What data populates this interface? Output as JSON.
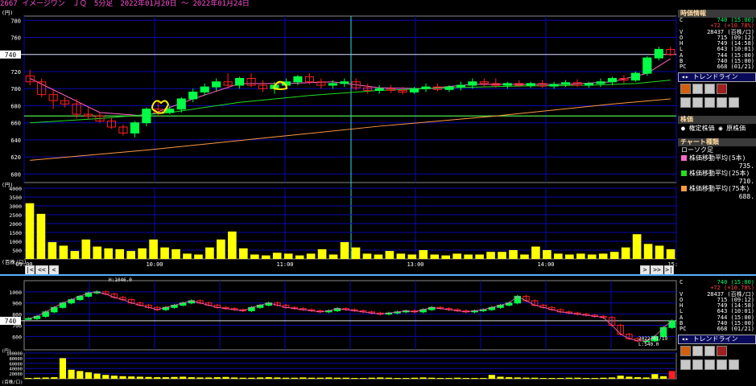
{
  "header": {
    "title": "2667 イメージワン　ＪＱ　5分足　2022年01月20日 〜 2022年01月24日"
  },
  "quote_panel": {
    "title": "時価情報",
    "rows": [
      {
        "k": "C",
        "v": "740 (15:00)",
        "cls": "up"
      },
      {
        "k": "",
        "v": "+72 (+10.78%)",
        "cls": "red"
      },
      {
        "k": "V",
        "v": "28437 (百株/口)",
        "cls": ""
      },
      {
        "k": "O",
        "v": "715 (09:12)",
        "cls": ""
      },
      {
        "k": "H",
        "v": "749 (14:58)",
        "cls": ""
      },
      {
        "k": "L",
        "v": "643 (10:01)",
        "cls": ""
      },
      {
        "k": "A",
        "v": "744 (15:00)",
        "cls": ""
      },
      {
        "k": "B",
        "v": "740 (15:00)",
        "cls": ""
      },
      {
        "k": "PC",
        "v": "668 (01/21)",
        "cls": ""
      }
    ]
  },
  "trendline_label": "トレンドライン",
  "price_section": {
    "title": "株価",
    "option1": "権定株価",
    "option2": "原株価"
  },
  "chart_type": {
    "title": "チャート種類",
    "candle": "ローソク足",
    "ma5": "株価移動平均(5本)",
    "ma5_val": "735.",
    "ma25": "株価移動平均(25本)",
    "ma25_val": "710.",
    "ma75": "株価移動平均(75本)",
    "ma75_val": "688."
  },
  "mini_quote_rows": [
    {
      "k": "C",
      "v": "740 (15:00)",
      "cls": "up"
    },
    {
      "k": "",
      "v": "+72 (+10.78%)",
      "cls": "red"
    },
    {
      "k": "V",
      "v": "28437 (百株/口)",
      "cls": ""
    },
    {
      "k": "O",
      "v": "715 (09:12)",
      "cls": ""
    },
    {
      "k": "H",
      "v": "749 (14:58)",
      "cls": ""
    },
    {
      "k": "L",
      "v": "643 (10:01)",
      "cls": ""
    },
    {
      "k": "A",
      "v": "744 (15:00)",
      "cls": ""
    },
    {
      "k": "B",
      "v": "740 (15:00)",
      "cls": ""
    },
    {
      "k": "PC",
      "v": "668 (01/21)",
      "cls": ""
    }
  ],
  "colors": {
    "up": "#00ff44",
    "down": "#ff2020",
    "ma5": "#ff66cc",
    "ma25": "#22dd22",
    "ma75": "#ff9944",
    "grid": "#0a0ab0",
    "volume": "#ffff00",
    "hline": "#55ff55",
    "vline": "#33dddd"
  },
  "chart_data": [
    {
      "type": "candlestick",
      "name": "main",
      "ylim": [
        590,
        785
      ],
      "y_ticks": [
        600,
        620,
        640,
        660,
        680,
        700,
        720,
        740,
        760,
        780
      ],
      "y_tick_labels": [
        "600",
        "620",
        "640",
        "660",
        "680",
        "700",
        "720",
        "740",
        "760",
        "780"
      ],
      "y_unit": "(円)",
      "current_price_label": "740",
      "current_price": 740,
      "reference_line": 668,
      "x_tick_labels": [
        {
          "label": "09:00",
          "i": 0
        },
        {
          "label": "10:00",
          "i": 12
        },
        {
          "label": "11:00",
          "i": 24
        },
        {
          "label": "13:00",
          "i": 36
        },
        {
          "label": "14:00",
          "i": 48
        },
        {
          "label": "15:00",
          "i": 60
        }
      ],
      "candles": [
        [
          715,
          722,
          704,
          708
        ],
        [
          708,
          712,
          690,
          693
        ],
        [
          693,
          700,
          676,
          686
        ],
        [
          686,
          690,
          678,
          682
        ],
        [
          682,
          688,
          665,
          670
        ],
        [
          670,
          678,
          664,
          668
        ],
        [
          668,
          672,
          660,
          662
        ],
        [
          662,
          666,
          653,
          655
        ],
        [
          655,
          658,
          645,
          648
        ],
        [
          648,
          662,
          643,
          660
        ],
        [
          660,
          678,
          656,
          676
        ],
        [
          676,
          684,
          668,
          672
        ],
        [
          672,
          680,
          670,
          676
        ],
        [
          676,
          690,
          672,
          688
        ],
        [
          688,
          700,
          684,
          696
        ],
        [
          696,
          706,
          692,
          702
        ],
        [
          702,
          712,
          697,
          708
        ],
        [
          708,
          718,
          700,
          704
        ],
        [
          704,
          714,
          700,
          712
        ],
        [
          712,
          718,
          702,
          704
        ],
        [
          704,
          710,
          696,
          700
        ],
        [
          700,
          708,
          694,
          704
        ],
        [
          704,
          712,
          700,
          708
        ],
        [
          708,
          716,
          704,
          714
        ],
        [
          714,
          718,
          705,
          708
        ],
        [
          708,
          712,
          700,
          704
        ],
        [
          704,
          710,
          700,
          706
        ],
        [
          706,
          712,
          702,
          708
        ],
        [
          708,
          712,
          698,
          701
        ],
        [
          701,
          706,
          694,
          698
        ],
        [
          698,
          704,
          694,
          700
        ],
        [
          700,
          704,
          695,
          698
        ],
        [
          698,
          702,
          693,
          696
        ],
        [
          696,
          702,
          694,
          700
        ],
        [
          700,
          706,
          696,
          702
        ],
        [
          702,
          706,
          697,
          699
        ],
        [
          699,
          704,
          696,
          702
        ],
        [
          702,
          708,
          698,
          704
        ],
        [
          704,
          712,
          700,
          708
        ],
        [
          708,
          712,
          702,
          706
        ],
        [
          706,
          712,
          701,
          704
        ],
        [
          704,
          708,
          700,
          706
        ],
        [
          706,
          710,
          702,
          704
        ],
        [
          704,
          708,
          701,
          706
        ],
        [
          706,
          710,
          701,
          703
        ],
        [
          703,
          708,
          700,
          705
        ],
        [
          705,
          710,
          702,
          707
        ],
        [
          707,
          711,
          702,
          704
        ],
        [
          704,
          708,
          701,
          706
        ],
        [
          706,
          712,
          702,
          708
        ],
        [
          708,
          714,
          704,
          712
        ],
        [
          712,
          716,
          706,
          710
        ],
        [
          710,
          720,
          708,
          718
        ],
        [
          718,
          738,
          715,
          736
        ],
        [
          736,
          749,
          733,
          746
        ],
        [
          746,
          749,
          738,
          740
        ]
      ],
      "ma5": [
        [
          0,
          712
        ],
        [
          6,
          672
        ],
        [
          10,
          668
        ],
        [
          14,
          688
        ],
        [
          18,
          706
        ],
        [
          22,
          706
        ],
        [
          26,
          708
        ],
        [
          30,
          701
        ],
        [
          34,
          700
        ],
        [
          38,
          705
        ],
        [
          42,
          705
        ],
        [
          46,
          705
        ],
        [
          50,
          708
        ],
        [
          53,
          718
        ],
        [
          55,
          735
        ]
      ],
      "ma25": [
        [
          0,
          660
        ],
        [
          6,
          665
        ],
        [
          12,
          672
        ],
        [
          18,
          684
        ],
        [
          24,
          692
        ],
        [
          30,
          698
        ],
        [
          36,
          701
        ],
        [
          42,
          703
        ],
        [
          48,
          704
        ],
        [
          52,
          706
        ],
        [
          55,
          710
        ]
      ],
      "ma75": [
        [
          0,
          616
        ],
        [
          10,
          628
        ],
        [
          20,
          642
        ],
        [
          30,
          656
        ],
        [
          40,
          668
        ],
        [
          50,
          682
        ],
        [
          55,
          688
        ]
      ]
    },
    {
      "type": "bar",
      "name": "main-volume",
      "ylim": [
        0,
        4000
      ],
      "y_ticks": [
        500,
        1000,
        1500,
        2000,
        2500,
        3000,
        3500,
        4000
      ],
      "y_tick_labels": [
        "500",
        "1000",
        "1500",
        "2000",
        "2500",
        "3000",
        "3500",
        "4000"
      ],
      "y_unit": "(円)",
      "y_unit2": "(百株/口)",
      "values": [
        3150,
        2550,
        950,
        750,
        450,
        1100,
        700,
        600,
        550,
        450,
        600,
        1100,
        650,
        550,
        300,
        250,
        650,
        1100,
        1550,
        600,
        250,
        200,
        350,
        300,
        200,
        300,
        550,
        250,
        950,
        650,
        300,
        250,
        450,
        300,
        250,
        500,
        250,
        200,
        300,
        250,
        250,
        400,
        400,
        500,
        250,
        700,
        500,
        300,
        250,
        300,
        250,
        300,
        400,
        650,
        1400,
        850,
        750,
        550
      ]
    },
    {
      "type": "candlestick",
      "name": "mini",
      "ylim": [
        480,
        1100
      ],
      "y_ticks": [
        600,
        700,
        800,
        900,
        1000
      ],
      "y_tick_labels": [
        "600",
        "700",
        "800",
        "900",
        "1000"
      ],
      "current_price_label": "740",
      "current_price": 740,
      "annotation_high": "H:1046.0",
      "annotation_low_date": "2022/01/19",
      "annotation_low": "L:540.0",
      "series_close": [
        760,
        780,
        820,
        860,
        900,
        930,
        960,
        990,
        1000,
        980,
        950,
        930,
        900,
        880,
        860,
        840,
        860,
        880,
        900,
        920,
        900,
        880,
        860,
        850,
        840,
        830,
        860,
        880,
        900,
        880,
        860,
        850,
        840,
        830,
        820,
        830,
        850,
        840,
        830,
        820,
        810,
        800,
        810,
        820,
        830,
        820,
        840,
        860,
        850,
        840,
        830,
        820,
        830,
        840,
        860,
        880,
        900,
        960,
        920,
        880,
        860,
        840,
        820,
        810,
        800,
        790,
        780,
        770,
        700,
        620,
        580,
        560,
        560,
        600,
        680,
        740
      ]
    },
    {
      "type": "bar",
      "name": "mini-volume",
      "ylim": [
        0,
        100000
      ],
      "y_ticks": [
        20000,
        40000,
        60000,
        80000,
        100000
      ],
      "y_tick_labels": [
        "20000",
        "40000",
        "60000",
        "80000",
        "100000"
      ],
      "y_unit": "(円)",
      "y_unit2": "(百株/口)",
      "values": [
        3000,
        4000,
        5000,
        6000,
        80000,
        35000,
        30000,
        25000,
        20000,
        15000,
        12000,
        10000,
        9000,
        8000,
        7000,
        6000,
        6000,
        7000,
        8000,
        6000,
        5000,
        5000,
        6000,
        7000,
        5000,
        4000,
        4000,
        5000,
        6000,
        5000,
        4000,
        4000,
        5000,
        4000,
        4000,
        5000,
        4000,
        4000,
        3000,
        3000,
        4000,
        5000,
        4000,
        3000,
        3000,
        4000,
        5000,
        4000,
        3000,
        3000,
        4000,
        3000,
        3000,
        3000,
        15000,
        8000,
        6000,
        5000,
        4000,
        4000,
        3000,
        3000,
        3000,
        4000,
        4000,
        3000,
        3000,
        4000,
        5000,
        12000,
        8000,
        6000,
        5000,
        18000,
        10000,
        30000
      ]
    }
  ]
}
